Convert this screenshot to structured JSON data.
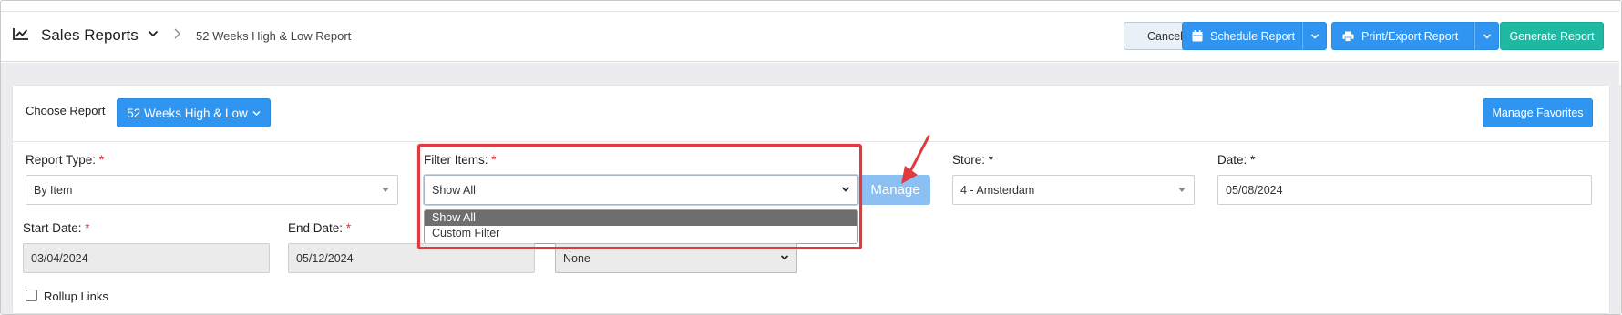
{
  "header": {
    "title": "Sales Reports",
    "breadcrumb_current": "52 Weeks High & Low Report",
    "buttons": {
      "cancel": "Cancel",
      "schedule": "Schedule Report",
      "print_export": "Print/Export Report",
      "generate": "Generate Report"
    }
  },
  "report_chooser": {
    "label": "Choose Report",
    "selected": "52 Weeks High & Low",
    "manage_favorites": "Manage Favorites"
  },
  "form": {
    "report_type": {
      "label": "Report Type:",
      "required_mark": "*",
      "value": "By Item"
    },
    "filter_items": {
      "label": "Filter Items:",
      "required_mark": "*",
      "value": "Show All",
      "manage_label": "Manage",
      "options": [
        "Show All",
        "Custom Filter"
      ],
      "selected_option": "Show All"
    },
    "store": {
      "label": "Store:",
      "required_mark": "*",
      "value": "4 - Amsterdam"
    },
    "date": {
      "label": "Date:",
      "required_mark": "*",
      "value": "05/08/2024"
    },
    "start_date": {
      "label": "Start Date:",
      "required_mark": "*",
      "value": "03/04/2024"
    },
    "end_date": {
      "label": "End Date:",
      "required_mark": "*",
      "value": "05/12/2024"
    },
    "extra_select": {
      "value": "None"
    },
    "rollup_links": {
      "label": "Rollup Links",
      "checked": false
    }
  },
  "colors": {
    "primary": "#2f95f0",
    "generate": "#1fb8a2",
    "highlight": "#e03a3e",
    "manage_disabled": "#8cc0f2"
  },
  "icons": [
    "chart-line-icon",
    "chevron-down-icon",
    "chevron-right-icon",
    "calendar-icon",
    "printer-icon",
    "arrow-annotation-icon"
  ]
}
